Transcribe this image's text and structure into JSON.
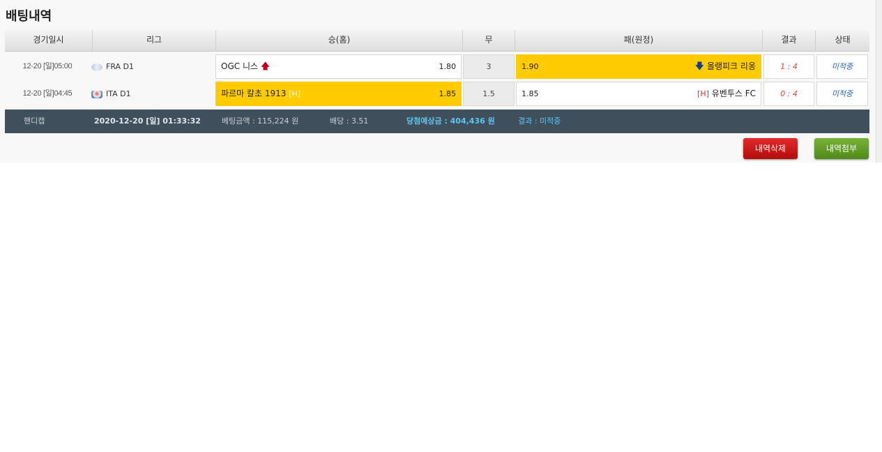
{
  "page_title": "배팅내역",
  "columns": [
    "경기일시",
    "리그",
    "승(홈)",
    "무",
    "패(원정)",
    "결과",
    "상태"
  ],
  "rows": [
    {
      "datetime": "12-20 [일]05:00",
      "league": "FRA D1",
      "home_team": "OGC 니스",
      "home_odds": "1.80",
      "home_icon": "arrow-up-icon",
      "draw": "3",
      "away_odds": "1.90",
      "away_team": "올랭피크 리옹",
      "away_icon": "arrow-down-icon",
      "result": "1 : 4",
      "status": "미적중",
      "selected": "away"
    },
    {
      "datetime": "12-20 [일]04:45",
      "league": "ITA D1",
      "home_team": "파르마 칼초 1913",
      "home_tag": "[H]",
      "home_odds": "1.85",
      "draw": "1.5",
      "away_odds": "1.85",
      "away_tag": "[H]",
      "away_team": "유벤투스 FC",
      "result": "0 : 4",
      "status": "미적중",
      "selected": "home"
    }
  ],
  "summary": {
    "type": "핸디캡",
    "bet_time": "2020-12-20 [일] 01:33:32",
    "bet_amount": "베팅금액 : 115,224 원",
    "odds": "배당 : 3.51",
    "expected_win": "당첨예상금 : 404,436 원",
    "result": "결과 : 미적중"
  },
  "buttons": {
    "delete": "내역삭제",
    "attach": "내역첨부"
  },
  "colors": {
    "selected_bg": "#ffcc00",
    "summary_bg": "#3f505c",
    "delete_btn": "#d41b1b",
    "attach_btn": "#63a02a",
    "result_text": "#e5462c",
    "status_text": "#2b67c8"
  }
}
